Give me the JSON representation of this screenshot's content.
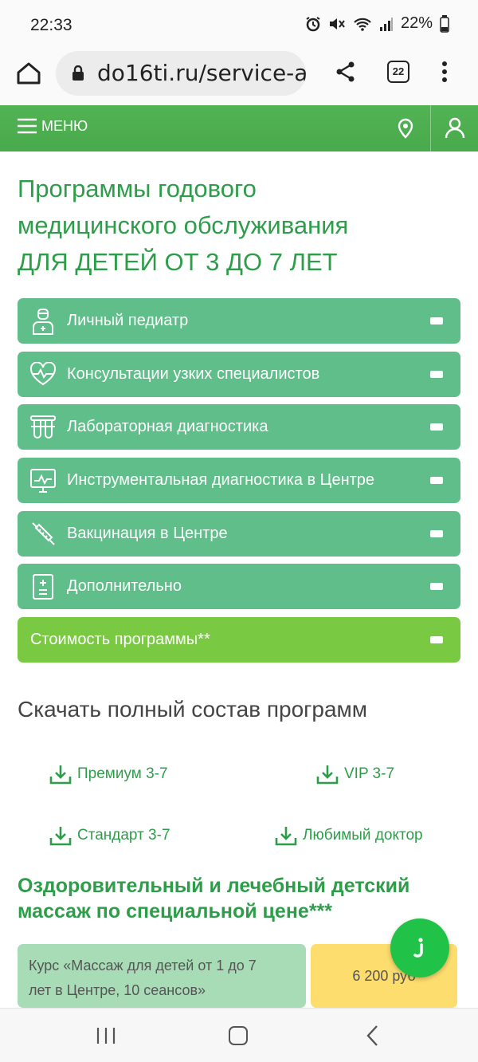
{
  "status": {
    "time": "22:33",
    "battery": "22%"
  },
  "browser": {
    "url": "do16ti.ru/service-a",
    "tab_count": "22"
  },
  "header": {
    "menu_label": "МЕНЮ"
  },
  "page": {
    "title_line1": "Программы годового",
    "title_line2": "медицинского обслуживания",
    "title_line3": "ДЛЯ ДЕТЕЙ ОТ 3 ДО 7 ЛЕТ"
  },
  "accordion": [
    {
      "label": "Личный педиатр",
      "icon": "doctor-icon"
    },
    {
      "label": "Консультации узких специалистов",
      "icon": "heart-pulse-icon"
    },
    {
      "label": "Лабораторная диагностика",
      "icon": "test-tubes-icon"
    },
    {
      "label": "Инструментальная диагностика в Центре",
      "icon": "monitor-icon"
    },
    {
      "label": "Вакцинация в Центре",
      "icon": "syringe-icon"
    },
    {
      "label": "Дополнительно",
      "icon": "document-plus-icon"
    },
    {
      "label": "Стоимость программы**",
      "icon": ""
    }
  ],
  "downloads": {
    "title": "Скачать полный состав программ",
    "links": [
      "Премиум 3-7",
      "VIP 3-7",
      "Стандарт 3-7",
      "Любимый доктор"
    ]
  },
  "massage": {
    "title_line1": "Оздоровительный и лечебный детский",
    "title_line2": "массаж по специальной цене***",
    "course_line1": "Курс «Массаж для детей от 1 до 7",
    "course_line2": "лет в Центре, 10 сеансов»",
    "price": "6 200 руб"
  },
  "colors": {
    "brand_green": "#4caf50",
    "accordion_green": "#5fbe89",
    "price_green": "#7ac943",
    "title_green": "#2e9d4a",
    "price_yellow": "#fddd6e"
  }
}
